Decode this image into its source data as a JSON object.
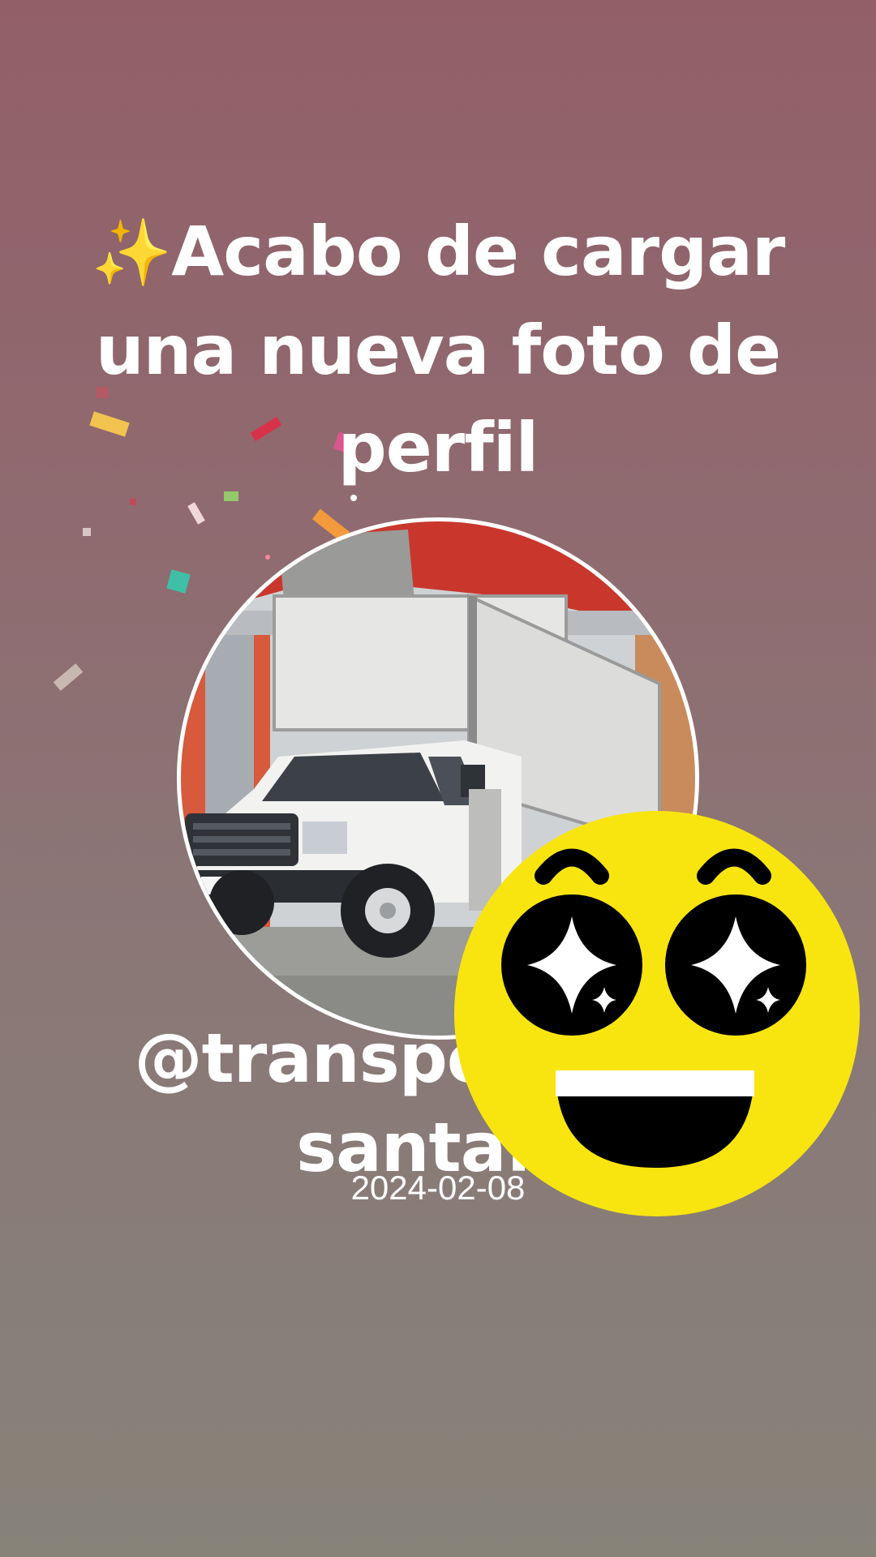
{
  "post": {
    "headline_icon": "sparkles-icon",
    "headline_sparkles": "✨",
    "headline_text": "Acabo de cargar una nueva foto de perfil",
    "username": "@transportes JR santafe",
    "date": "2024-02-08"
  },
  "sticker": {
    "icon": "star-eyes-grinning-face-icon",
    "face_color": "#f8e50f"
  },
  "colors": {
    "background_top": "#925f68",
    "background_bottom": "#878379",
    "text": "#ffffff"
  }
}
